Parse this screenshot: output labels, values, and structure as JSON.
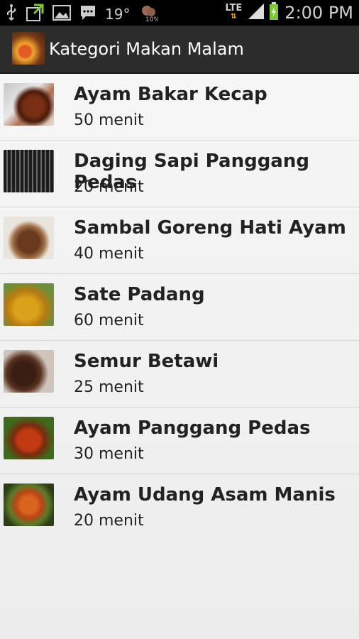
{
  "status_bar": {
    "temperature": "19°",
    "network": "LTE",
    "time": "2:00 PM"
  },
  "action_bar": {
    "title": "Kategori Makan Malam"
  },
  "menu": [
    {
      "name": "Ayam Bakar Kecap",
      "duration": "50 menit"
    },
    {
      "name": "Daging Sapi Panggang Pedas",
      "duration": "20 menit"
    },
    {
      "name": "Sambal Goreng Hati Ayam",
      "duration": "40 menit"
    },
    {
      "name": "Sate Padang",
      "duration": "60 menit"
    },
    {
      "name": "Semur Betawi",
      "duration": "25 menit"
    },
    {
      "name": "Ayam Panggang Pedas",
      "duration": "30 menit"
    },
    {
      "name": "Ayam Udang Asam Manis",
      "duration": "20 menit"
    }
  ]
}
